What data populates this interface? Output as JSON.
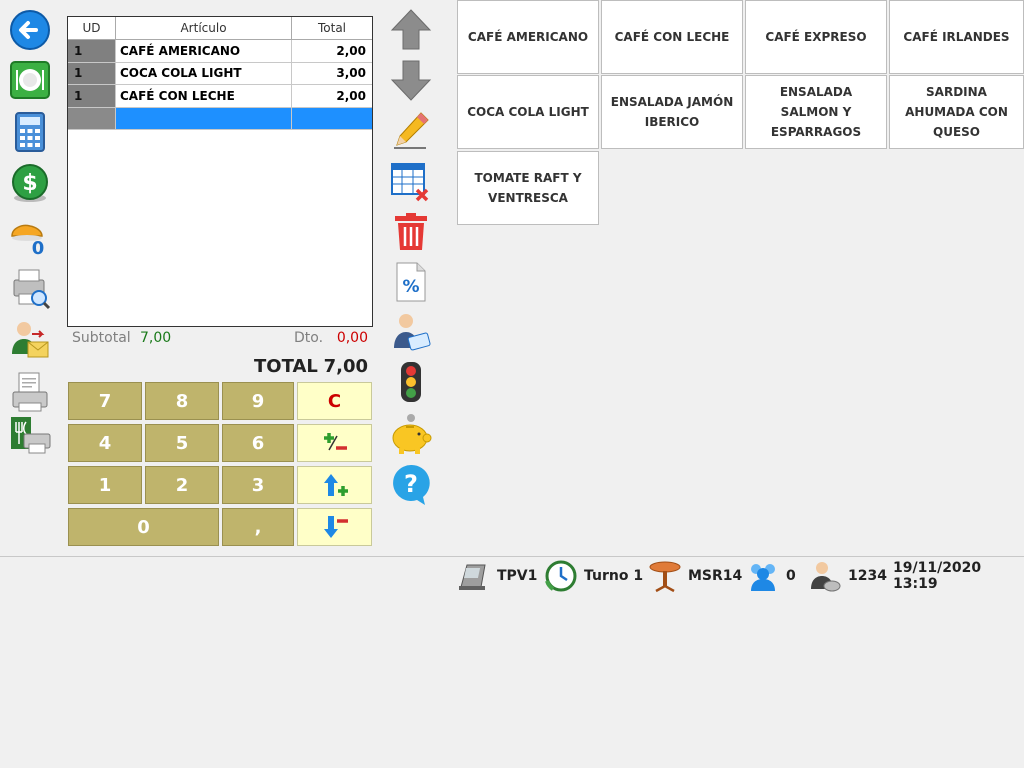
{
  "order": {
    "headers": {
      "ud": "UD",
      "articulo": "Artículo",
      "total": "Total"
    },
    "rows": [
      {
        "ud": "1",
        "articulo": "CAFÉ AMERICANO",
        "total": "2,00"
      },
      {
        "ud": "1",
        "articulo": "COCA COLA LIGHT",
        "total": "3,00"
      },
      {
        "ud": "1",
        "articulo": "CAFÉ CON LECHE",
        "total": "2,00"
      }
    ]
  },
  "summary": {
    "subtotal_label": "Subtotal",
    "subtotal_value": "7,00",
    "dto_label": "Dto.",
    "dto_value": "0,00",
    "total_label": "TOTAL",
    "total_value": "7,00"
  },
  "keypad": {
    "k7": "7",
    "k8": "8",
    "k9": "9",
    "clear": "C",
    "k4": "4",
    "k5": "5",
    "k6": "6",
    "k1": "1",
    "k2": "2",
    "k3": "3",
    "k0": "0",
    "comma": ","
  },
  "products": [
    "CAFÉ AMERICANO",
    "CAFÉ CON LECHE",
    "CAFÉ EXPRESO",
    "CAFÉ IRLANDES",
    "COCA COLA LIGHT",
    "ENSALADA JAMÓN IBERICO",
    "ENSALADA SALMON Y ESPARRAGOS",
    "SARDINA AHUMADA CON QUESO",
    "TOMATE RAFT Y VENTRESCA"
  ],
  "status": {
    "terminal": "TPV1",
    "shift": "Turno 1",
    "table": "MSR14",
    "diners": "0",
    "user": "1234",
    "datetime": "19/11/2020 13:19"
  },
  "left_icons": [
    "back-arrow-icon",
    "tables-icon",
    "calculator-icon",
    "cash-icon",
    "takeaway-icon",
    "print-preview-icon",
    "send-order-icon",
    "print-ticket-icon",
    "kitchen-print-icon"
  ],
  "mid_icons": [
    "arrow-up-icon",
    "arrow-down-icon",
    "pencil-icon",
    "delete-line-icon",
    "trash-icon",
    "discount-icon",
    "client-card-icon",
    "traffic-light-icon",
    "piggy-bank-icon",
    "help-icon"
  ],
  "colors": {
    "accent": "#1e90ff",
    "keypad": "#bfb46c",
    "subtotal": "#1a7a1a",
    "discount": "#cc0000"
  }
}
